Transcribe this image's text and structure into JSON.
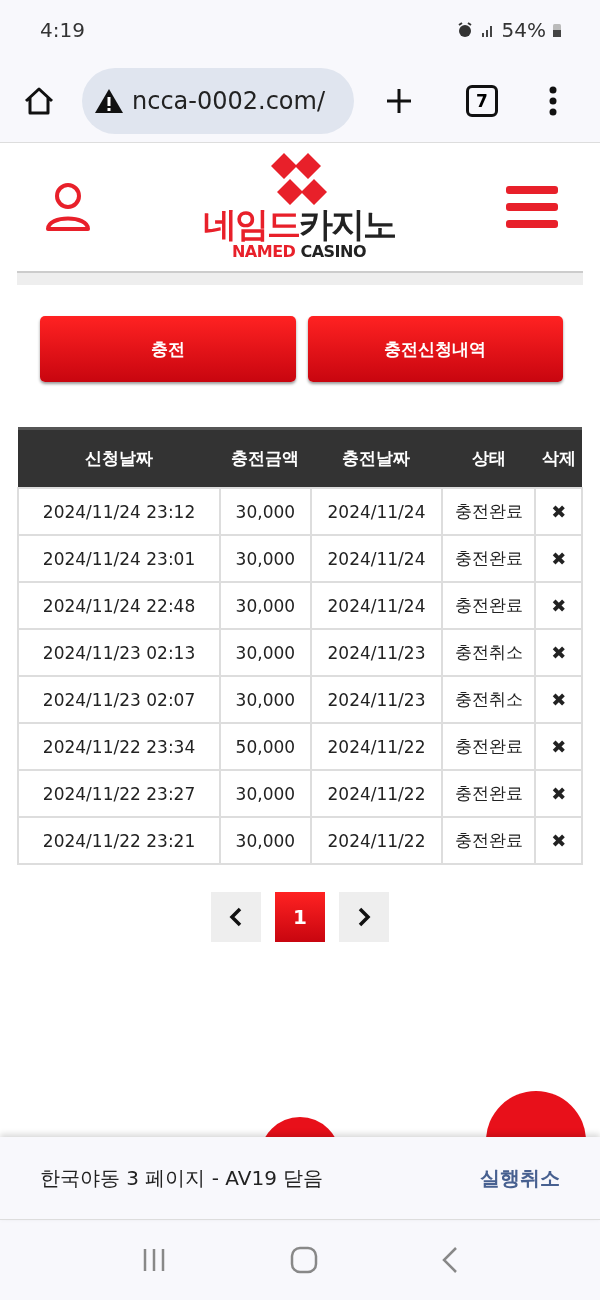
{
  "status_bar": {
    "time": "4:19",
    "battery": "54%"
  },
  "browser": {
    "url": "ncca-0002.com/",
    "tab_count": "7"
  },
  "header": {
    "logo": {
      "korean_red": "네임드",
      "korean_dark": "카지노",
      "english_red": "NAMED",
      "english_dark": "CASINO"
    }
  },
  "buttons": [
    "충전",
    "충전신청내역"
  ],
  "table": {
    "columns": [
      "신청날짜",
      "충전금액",
      "충전날짜",
      "상태",
      "삭제"
    ],
    "rows": [
      {
        "requested": "2024/11/24 23:12",
        "amount": "30,000",
        "charged": "2024/11/24",
        "status": "충전완료",
        "delete": "✖"
      },
      {
        "requested": "2024/11/24 23:01",
        "amount": "30,000",
        "charged": "2024/11/24",
        "status": "충전완료",
        "delete": "✖"
      },
      {
        "requested": "2024/11/24 22:48",
        "amount": "30,000",
        "charged": "2024/11/24",
        "status": "충전완료",
        "delete": "✖"
      },
      {
        "requested": "2024/11/23 02:13",
        "amount": "30,000",
        "charged": "2024/11/23",
        "status": "충전취소",
        "delete": "✖"
      },
      {
        "requested": "2024/11/23 02:07",
        "amount": "30,000",
        "charged": "2024/11/23",
        "status": "충전취소",
        "delete": "✖"
      },
      {
        "requested": "2024/11/22 23:34",
        "amount": "50,000",
        "charged": "2024/11/22",
        "status": "충전완료",
        "delete": "✖"
      },
      {
        "requested": "2024/11/22 23:27",
        "amount": "30,000",
        "charged": "2024/11/22",
        "status": "충전완료",
        "delete": "✖"
      },
      {
        "requested": "2024/11/22 23:21",
        "amount": "30,000",
        "charged": "2024/11/22",
        "status": "충전완료",
        "delete": "✖"
      }
    ]
  },
  "pagination": [
    {
      "kind": "prev",
      "selected": false
    },
    {
      "kind": "page",
      "label": "1",
      "selected": true
    },
    {
      "kind": "next",
      "selected": false
    }
  ],
  "snackbar": {
    "message": "한국야동 3 페이지 - AV19 닫음",
    "action": "실행취소"
  }
}
